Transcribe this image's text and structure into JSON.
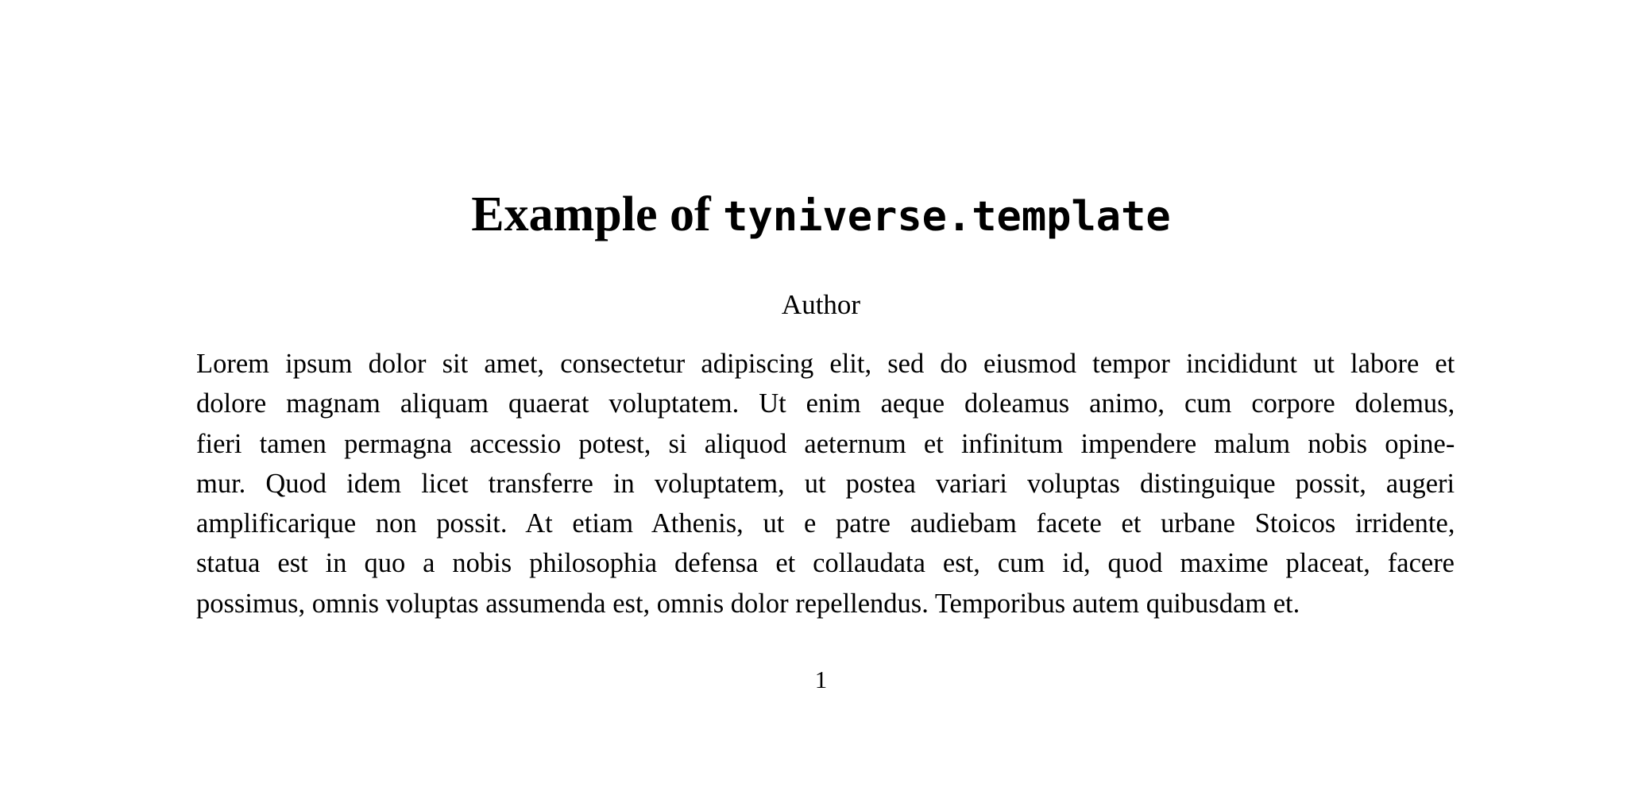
{
  "document": {
    "title_serif": "Example of ",
    "title_mono": "tyniverse.template",
    "author": "Author",
    "body_lines": [
      "Lorem ipsum dolor sit amet, consectetur adipiscing elit, sed do eiusmod tempor incididunt ut labore et",
      "dolore magnam aliquam quaerat voluptatem. Ut enim aeque doleamus animo, cum corpore dolemus,",
      "fieri tamen permagna accessio potest, si aliquod aeternum et infinitum impendere malum nobis opine-",
      "mur. Quod idem licet transferre in voluptatem, ut postea variari voluptas distinguique possit, augeri",
      "amplificarique non possit. At etiam Athenis, ut e patre audiebam facete et urbane Stoicos irridente,",
      "statua est in quo a nobis philosophia defensa et collaudata est, cum id, quod maxime placeat, facere",
      "possimus, omnis voluptas assumenda est, omnis dolor repellendus. Temporibus autem quibusdam et."
    ],
    "page_number": "1"
  },
  "colors": {
    "background": "#ffffff",
    "text": "#000000"
  }
}
